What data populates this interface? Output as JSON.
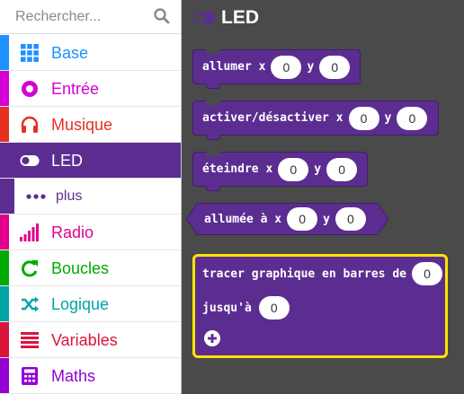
{
  "search": {
    "placeholder": "Rechercher..."
  },
  "sidebar": {
    "items": [
      {
        "label": "Base",
        "color": "#1e90ff",
        "icon": "grid-icon"
      },
      {
        "label": "Entrée",
        "color": "#d400d4",
        "icon": "circle-dot-icon"
      },
      {
        "label": "Musique",
        "color": "#e63022",
        "icon": "headphones-icon"
      },
      {
        "label": "LED",
        "color": "#5c2d91",
        "icon": "toggle-icon",
        "selected": true
      },
      {
        "label": "plus",
        "color": "#5c2d91",
        "icon": "more-dots-icon",
        "sub": true
      },
      {
        "label": "Radio",
        "color": "#e3008c",
        "icon": "signal-bars-icon"
      },
      {
        "label": "Boucles",
        "color": "#00aa00",
        "icon": "refresh-icon"
      },
      {
        "label": "Logique",
        "color": "#00a4a6",
        "icon": "shuffle-icon"
      },
      {
        "label": "Variables",
        "color": "#dc143c",
        "icon": "list-lines-icon"
      },
      {
        "label": "Maths",
        "color": "#9400d3",
        "icon": "calculator-icon"
      }
    ]
  },
  "flyout": {
    "title": "LED",
    "accent": "#5c2d91",
    "highlight": "#ffe500",
    "blocks": {
      "plot": {
        "label": "allumer x",
        "x": "0",
        "y_label": "y",
        "y": "0"
      },
      "toggle": {
        "label": "activer/désactiver x",
        "x": "0",
        "y_label": "y",
        "y": "0"
      },
      "unplot": {
        "label": "éteindre x",
        "x": "0",
        "y_label": "y",
        "y": "0"
      },
      "point": {
        "label": "allumée à x",
        "x": "0",
        "y_label": "y",
        "y": "0"
      },
      "graph": {
        "label": "tracer graphique en barres de",
        "value": "0",
        "upto_label": "jusqu'à",
        "upto": "0"
      }
    }
  }
}
